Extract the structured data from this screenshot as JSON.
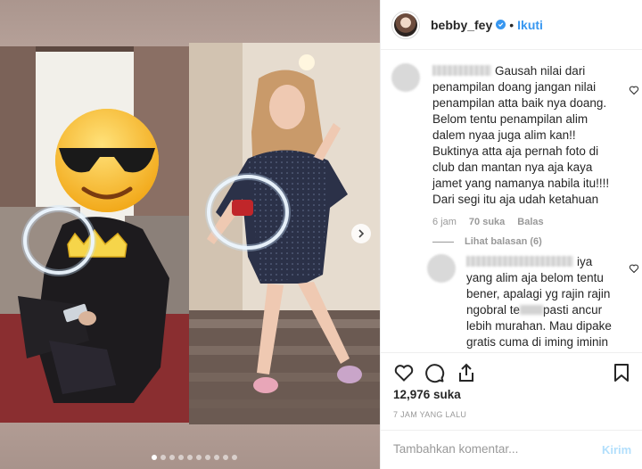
{
  "post": {
    "username": "bebby_fey",
    "separator": "•",
    "follow_label": "Ikuti",
    "verified": true
  },
  "comments": [
    {
      "text": "Gausah nilai dari penampilan doang jangan nilai penampilan atta baik nya doang. Belom tentu penampilan alim dalem nyaa juga alim kan!! Buktinya atta aja pernah foto di club dan mantan nya aja kaya jamet yang namanya nabila itu!!!! Dari segi itu aja udah ketahuan",
      "time": "6 jam",
      "likes": "70 suka",
      "reply_label": "Balas",
      "view_replies": "Lihat balasan (6)"
    },
    {
      "text_part1": "iya yang alim aja belom tentu bener, apalagi yg rajin rajin ngobral te",
      "text_part2": "pasti ancur lebih murahan. Mau dipake gratis cuma di iming iminin diajak bikin konten"
    }
  ],
  "likes_count": "12,976 suka",
  "time_ago": "7 JAM YANG LALU",
  "comment_box": {
    "placeholder": "Tambahkan komentar...",
    "post_label": "Kirim"
  },
  "carousel": {
    "total_dots": 10,
    "active_index": 0
  },
  "icons": {
    "like": "heart-icon",
    "comment": "comment-icon",
    "share": "share-icon",
    "save": "bookmark-icon",
    "next": "chevron-right-icon",
    "verified": "verified-badge-icon"
  },
  "colors": {
    "accent": "#3897f0",
    "muted": "#999999",
    "post_disabled": "#b2dffc"
  }
}
